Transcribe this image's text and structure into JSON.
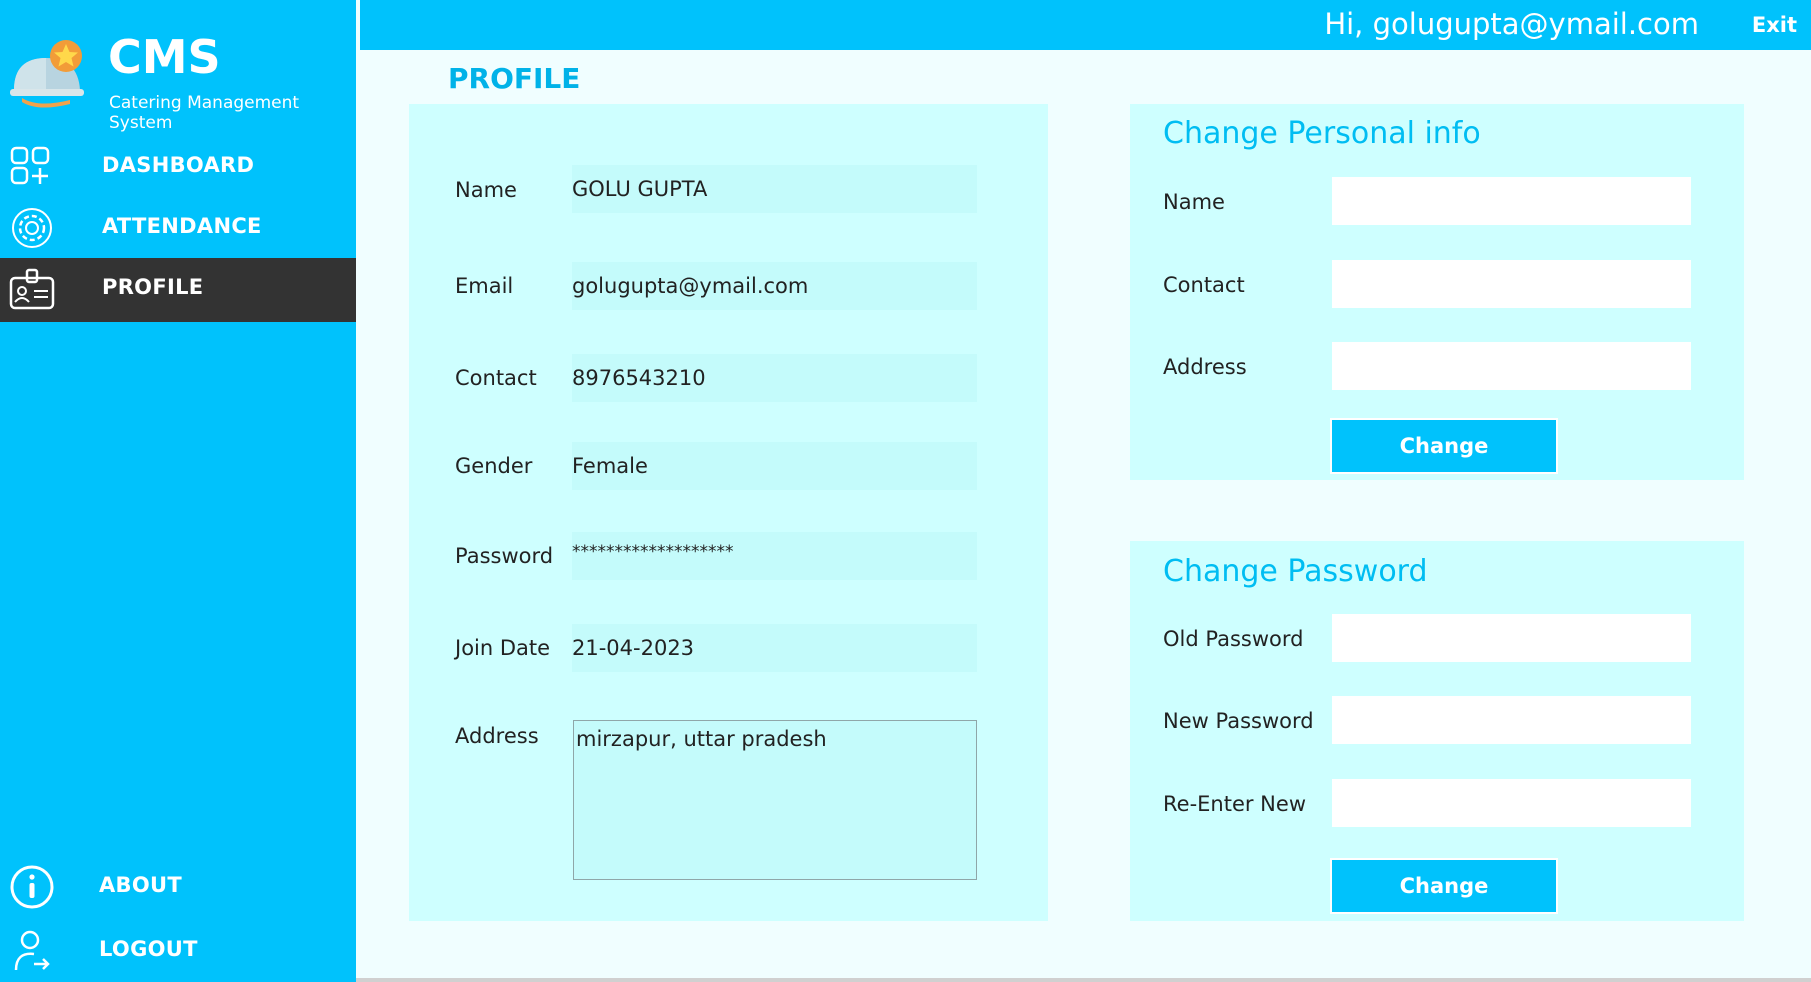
{
  "app": {
    "title": "CMS",
    "subtitle": "Catering Management System"
  },
  "sidebar": {
    "items": [
      {
        "label": "DASHBOARD",
        "icon": "dashboard-icon"
      },
      {
        "label": "ATTENDANCE",
        "icon": "gear-icon"
      },
      {
        "label": "PROFILE",
        "icon": "id-card-icon",
        "active": true
      },
      {
        "label": "ABOUT",
        "icon": "info-icon"
      },
      {
        "label": "LOGOUT",
        "icon": "logout-icon"
      }
    ]
  },
  "header": {
    "greeting": "Hi, golugupta@ymail.com",
    "exit_label": "Exit"
  },
  "page": {
    "title": "PROFILE"
  },
  "profile": {
    "fields": [
      {
        "label": "Name",
        "value": "GOLU GUPTA"
      },
      {
        "label": "Email",
        "value": "golugupta@ymail.com"
      },
      {
        "label": "Contact",
        "value": "8976543210"
      },
      {
        "label": "Gender",
        "value": "Female"
      },
      {
        "label": "Password",
        "value": "*******************"
      },
      {
        "label": "Join Date",
        "value": "21-04-2023"
      }
    ],
    "address_label": "Address",
    "address_value": "mirzapur, uttar pradesh"
  },
  "personal_info": {
    "heading": "Change Personal info",
    "name_label": "Name",
    "contact_label": "Contact",
    "address_label": "Address",
    "name_value": "",
    "contact_value": "",
    "address_value": "",
    "button_label": "Change"
  },
  "password": {
    "heading": "Change Password",
    "old_label": "Old Password",
    "new_label": "New Password",
    "reenter_label": "Re-Enter New",
    "old_value": "",
    "new_value": "",
    "reenter_value": "",
    "button_label": "Change"
  },
  "colors": {
    "accent": "#00c2fc",
    "panel": "#ceffff",
    "active_nav": "#333333",
    "heading": "#00bdf2"
  }
}
